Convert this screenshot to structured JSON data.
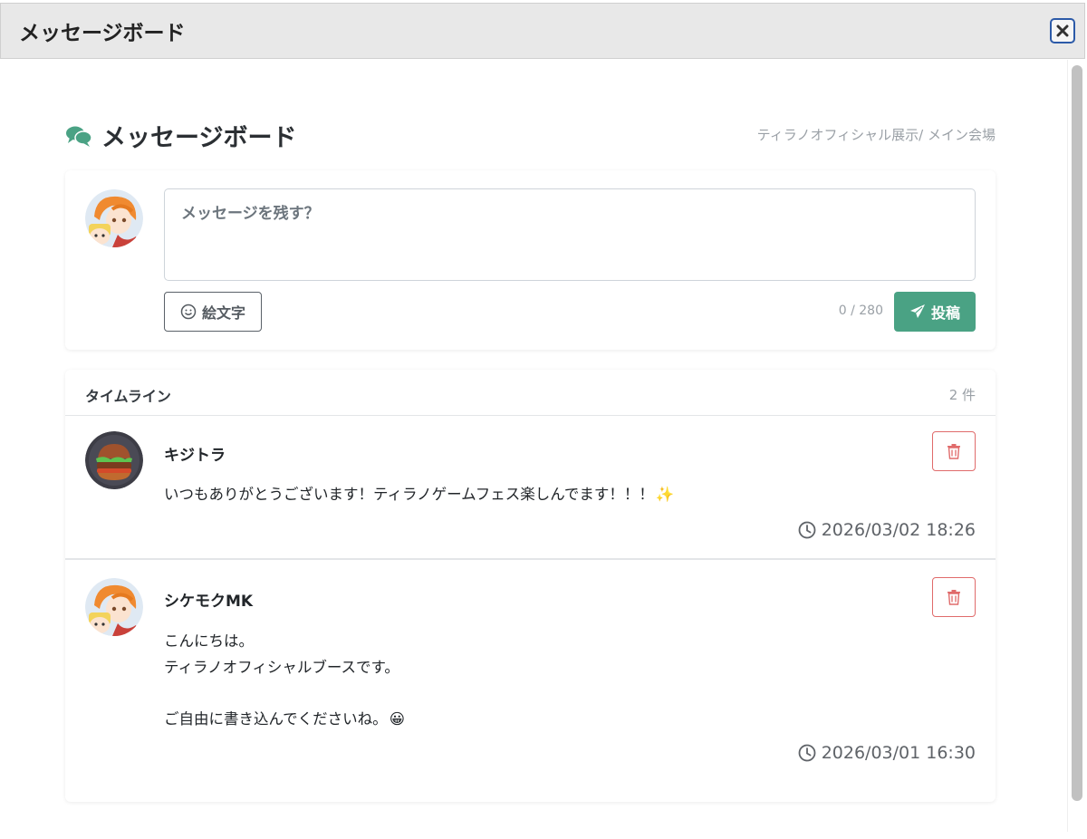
{
  "window": {
    "title": "メッセージボード"
  },
  "board": {
    "title": "メッセージボード",
    "location": "ティラノオフィシャル展示/ メイン会場"
  },
  "compose": {
    "placeholder": "メッセージを残す？",
    "emoji_label": "絵文字",
    "char_count": "0 / 280",
    "post_label": "投稿"
  },
  "timeline": {
    "title": "タイムライン",
    "count": "2 件",
    "posts": [
      {
        "author": "キジトラ",
        "lines": [
          "いつもありがとうございます！ティラノゲームフェス楽しんでます！！！"
        ],
        "emoji": "✨",
        "timestamp": "2026/03/02 18:26"
      },
      {
        "author": "シケモクMK",
        "lines": [
          "こんにちは。",
          "ティラノオフィシャルブースです。",
          "",
          "ご自由に書き込んでくださいね。"
        ],
        "emoji": "😀",
        "timestamp": "2026/03/01 16:30"
      }
    ]
  },
  "colors": {
    "accent": "#4aa284",
    "danger": "#e06b6b",
    "close_border": "#2c5aa8"
  }
}
